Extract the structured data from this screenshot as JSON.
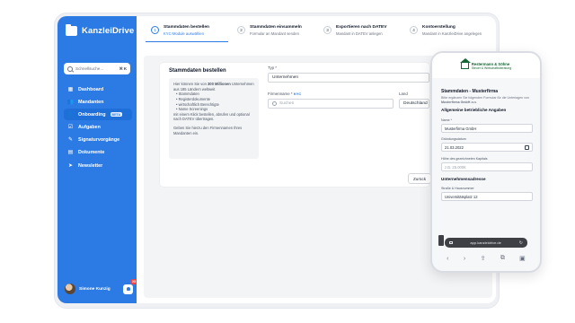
{
  "app": {
    "name": "KanzleiDrive"
  },
  "search": {
    "placeholder": "Schnellsuche...",
    "shortcut": "⌘ K"
  },
  "nav": [
    {
      "label": "Dashboard",
      "icon": "grid-icon"
    },
    {
      "label": "Mandanten",
      "icon": "users-icon"
    },
    {
      "label": "Onboarding",
      "icon": "user-plus-icon",
      "badge": "BETA",
      "active": true
    },
    {
      "label": "Aufgaben",
      "icon": "checklist-icon"
    },
    {
      "label": "Signaturvorgänge",
      "icon": "pen-icon"
    },
    {
      "label": "Dokumente",
      "icon": "document-icon"
    },
    {
      "label": "Newsletter",
      "icon": "send-icon"
    }
  ],
  "user": {
    "name": "Simone Kunzig",
    "notifications": "23"
  },
  "steps": [
    {
      "num": "1",
      "title": "Stammdaten bestellen",
      "sub": "KYC-Module auswählen",
      "active": true
    },
    {
      "num": "2",
      "title": "Stammdaten einsammeln",
      "sub": "Formular an Mandant senden"
    },
    {
      "num": "3",
      "title": "Exportieren nach DATEV",
      "sub": "Mandant in DATEV anlegen"
    },
    {
      "num": "4",
      "title": "Kontoerstellung",
      "sub": "Mandant in KanzleiDrive angelegen"
    }
  ],
  "form": {
    "title": "Stammdaten bestellen",
    "info_intro_pre": "Hier können Sie von ",
    "info_intro_bold": "300 Millionen",
    "info_intro_post": " Unternehmen aus 185 Ländern weltweit",
    "info_items": [
      "Stammdaten",
      "Registerdokumente",
      "wirtschaftlich Berechtigte",
      "Name Screenings"
    ],
    "info_outro": "mit einem Klick bestellen, abrufen und optional nach DATEV übertragen.",
    "info_hint": "Geben Sie hierzu den Firmennamen Ihres Mandanten ein.",
    "type_label": "Typ *",
    "type_value": "Unternehmen",
    "company_label": "Firmenname *",
    "kyc_badge": "KYC",
    "company_placeholder": "Suchen",
    "country_label": "Land",
    "country_value": "Deutschland",
    "back_button": "Zurück"
  },
  "phone": {
    "brand_title": "Restermann & Söhne",
    "brand_sub": "Steuer & Wirtschaftsberatung",
    "heading": "Stammdaten - Musterfirma",
    "intro_pre": "Bitte ergänzen Sie folgenden Formular für die Unterlagen von ",
    "intro_bold": "Musterfirma GmbH",
    "intro_post": " aus.",
    "section1": "Allgemeine betriebliche Angaben",
    "name_label": "Name *",
    "name_value": "Musterfirma GmbH",
    "date_label": "Gründungsdatum",
    "date_value": "21.03.2022",
    "capital_label": "Höhe des gezeichneten Kapitals",
    "capital_placeholder": "z.B. 25.000€",
    "section2": "Unternehmensadresse",
    "street_label": "Straße & Hausnummer",
    "street_value": "Universitätsplatz 12",
    "url": "app.kanzleidrive.de"
  }
}
